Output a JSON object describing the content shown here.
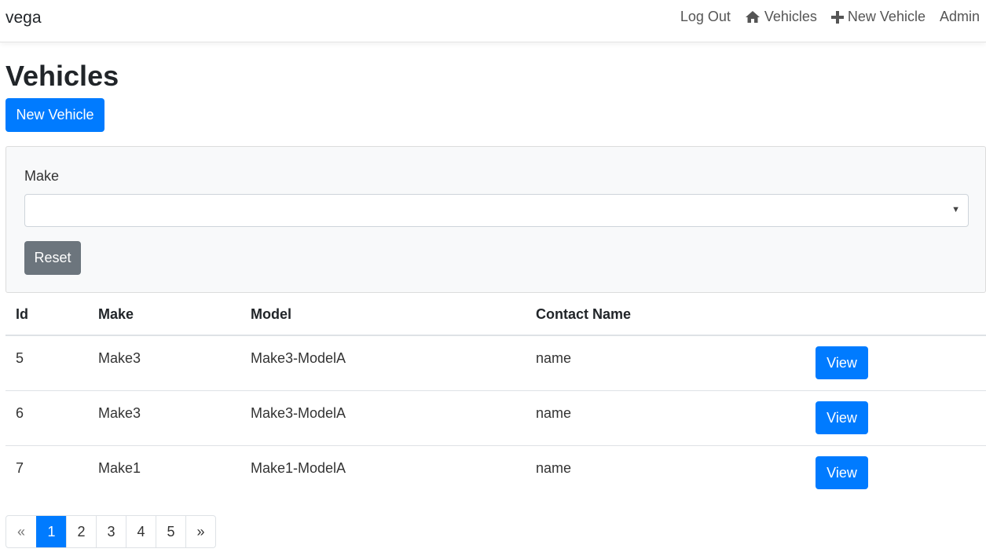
{
  "navbar": {
    "brand": "vega",
    "links": {
      "logout": "Log Out",
      "vehicles": "Vehicles",
      "new_vehicle": "New Vehicle",
      "admin": "Admin"
    }
  },
  "page": {
    "title": "Vehicles",
    "new_button": "New Vehicle"
  },
  "filter": {
    "make_label": "Make",
    "make_selected": "",
    "reset_button": "Reset"
  },
  "table": {
    "columns": [
      "Id",
      "Make",
      "Model",
      "Contact Name"
    ],
    "rows": [
      {
        "id": "5",
        "make": "Make3",
        "model": "Make3-ModelA",
        "contact": "name",
        "action": "View"
      },
      {
        "id": "6",
        "make": "Make3",
        "model": "Make3-ModelA",
        "contact": "name",
        "action": "View"
      },
      {
        "id": "7",
        "make": "Make1",
        "model": "Make1-ModelA",
        "contact": "name",
        "action": "View"
      }
    ]
  },
  "pagination": {
    "prev": "«",
    "pages": [
      "1",
      "2",
      "3",
      "4",
      "5"
    ],
    "active": "1",
    "next": "»"
  },
  "colors": {
    "primary": "#007bff",
    "secondary": "#6c757d",
    "panel": "#f8f9fa"
  },
  "icons": {
    "vehicles": "home-icon",
    "new_vehicle": "plus-icon",
    "select": "caret-down-icon"
  }
}
